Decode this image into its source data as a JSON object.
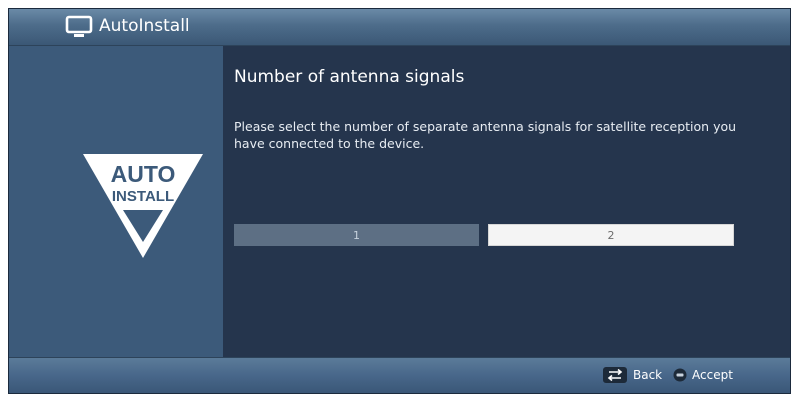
{
  "header": {
    "title": "AutoInstall",
    "icon": "tv-icon"
  },
  "sidebar": {
    "logo": {
      "line1": "AUTO",
      "line2": "INSTALL",
      "icon": "auto-install-logo"
    }
  },
  "main": {
    "title": "Number of antenna signals",
    "description": "Please select the number of separate antenna signals for satellite reception you have connected to the device.",
    "options": [
      {
        "label": "1",
        "selected": false
      },
      {
        "label": "2",
        "selected": true
      }
    ]
  },
  "footer": {
    "back_label": "Back",
    "accept_label": "Accept",
    "back_icon": "back-arrows-icon",
    "ok_icon": "ok-icon"
  },
  "colors": {
    "screen_bg": "#25354d",
    "sidebar_bg": "#3c5a7a",
    "option_unselected": "#5d6f84",
    "option_selected": "#f4f4f4"
  }
}
